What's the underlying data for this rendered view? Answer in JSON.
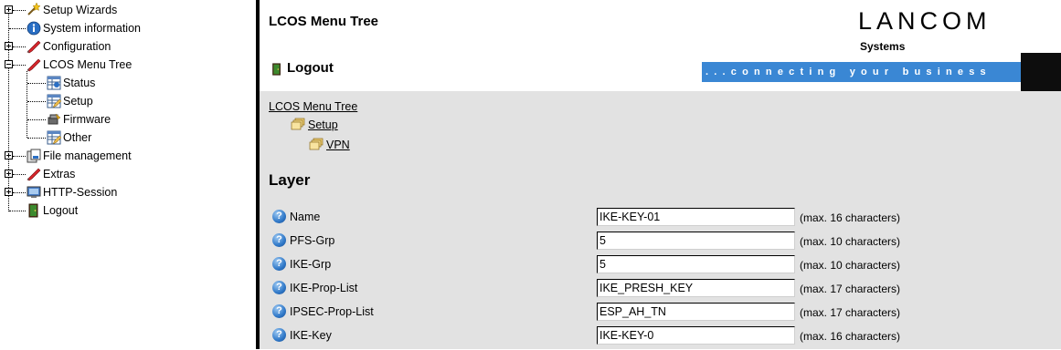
{
  "tree": {
    "items": [
      {
        "label": "Setup Wizards",
        "icon": "wand-icon",
        "expander": "plus"
      },
      {
        "label": "System information",
        "icon": "info-icon",
        "expander": "none"
      },
      {
        "label": "Configuration",
        "icon": "config-icon",
        "expander": "plus"
      },
      {
        "label": "LCOS Menu Tree",
        "icon": "config-icon",
        "expander": "minus"
      },
      {
        "label": "Status",
        "icon": "table-icon"
      },
      {
        "label": "Setup",
        "icon": "edit-table-icon"
      },
      {
        "label": "Firmware",
        "icon": "firmware-icon"
      },
      {
        "label": "Other",
        "icon": "edit-table-icon"
      },
      {
        "label": "File management",
        "icon": "file-management-icon",
        "expander": "plus"
      },
      {
        "label": "Extras",
        "icon": "config-icon",
        "expander": "plus"
      },
      {
        "label": "HTTP-Session",
        "icon": "monitor-icon",
        "expander": "plus"
      },
      {
        "label": "Logout",
        "icon": "logout-icon",
        "expander": "none"
      }
    ]
  },
  "header": {
    "title": "LCOS Menu Tree",
    "logout_label": "Logout",
    "brand": "LANCOM",
    "brand_sub": "Systems",
    "slogan": "...connecting your business",
    "accent_color": "#3a87d4"
  },
  "breadcrumb": {
    "root": "LCOS Menu Tree",
    "level1": "Setup",
    "level2": "VPN"
  },
  "section_title": "Layer",
  "fields": [
    {
      "label": "Name",
      "value": "IKE-KEY-01",
      "hint": "(max. 16 characters)"
    },
    {
      "label": "PFS-Grp",
      "value": "5",
      "hint": "(max. 10 characters)"
    },
    {
      "label": "IKE-Grp",
      "value": "5",
      "hint": "(max. 10 characters)"
    },
    {
      "label": "IKE-Prop-List",
      "value": "IKE_PRESH_KEY",
      "hint": "(max. 17 characters)"
    },
    {
      "label": "IPSEC-Prop-List",
      "value": "ESP_AH_TN",
      "hint": "(max. 17 characters)"
    },
    {
      "label": "IKE-Key",
      "value": "IKE-KEY-0",
      "hint": "(max. 16 characters)"
    }
  ]
}
